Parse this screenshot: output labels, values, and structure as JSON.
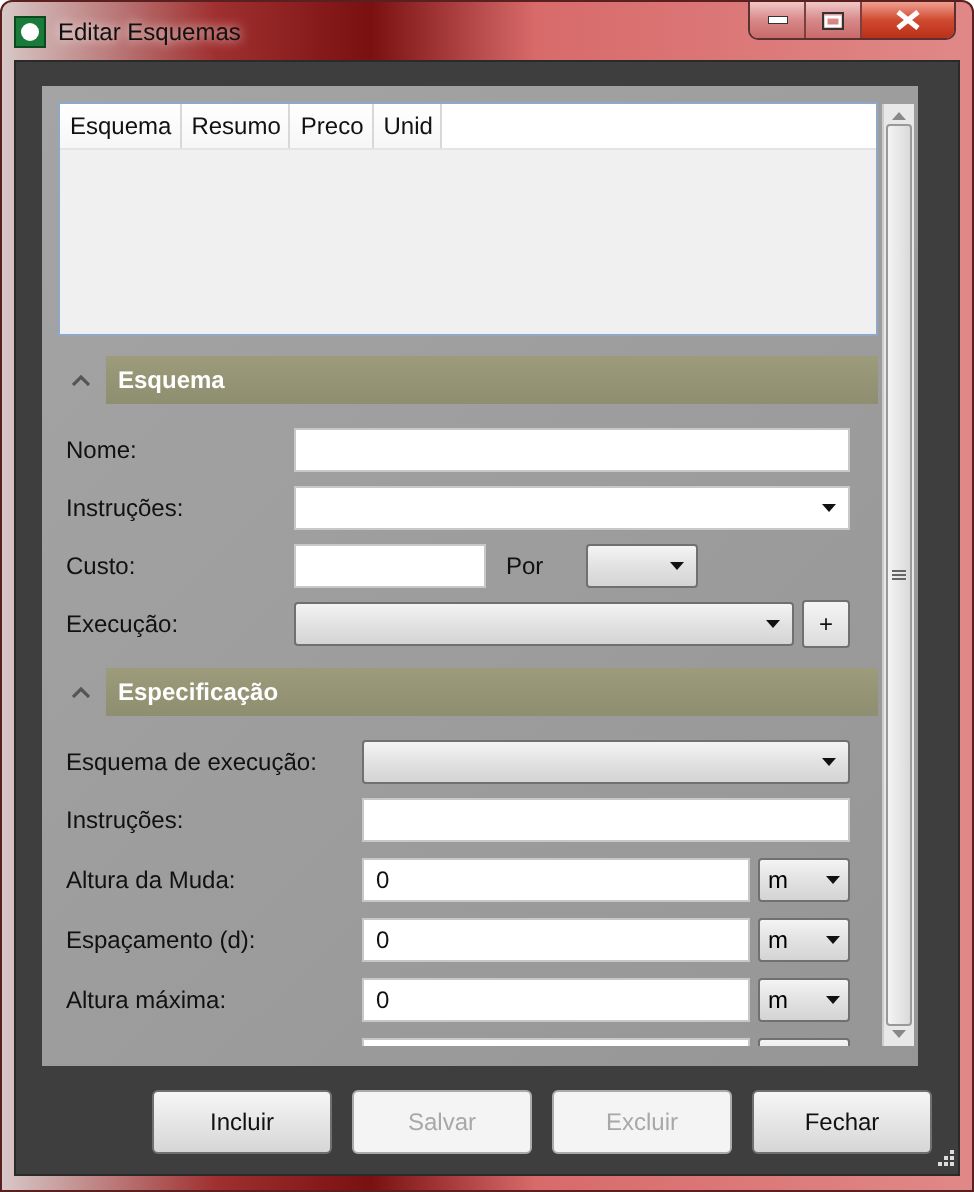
{
  "window": {
    "title": "Editar Esquemas"
  },
  "grid": {
    "columns": [
      "Esquema",
      "Resumo",
      "Preco",
      "Unid"
    ]
  },
  "sections": [
    {
      "title": "Esquema",
      "expanded": true,
      "fields": [
        {
          "kind": "text",
          "label": "Nome:"
        },
        {
          "kind": "editable_combo",
          "label": "Instruções:"
        },
        {
          "kind": "cost",
          "label": "Custo:",
          "per_label": "Por"
        },
        {
          "kind": "combo_add",
          "label": "Execução:",
          "button": "+"
        }
      ]
    },
    {
      "title": "Especificação",
      "expanded": true,
      "fields": [
        {
          "kind": "combo",
          "label": "Esquema de execução:"
        },
        {
          "kind": "text",
          "label": "Instruções:"
        },
        {
          "kind": "measure",
          "label": "Altura da Muda:",
          "value": "0",
          "unit": "m"
        },
        {
          "kind": "measure",
          "label": "Espaçamento (d):",
          "value": "0",
          "unit": "m"
        },
        {
          "kind": "measure",
          "label": "Altura máxima:",
          "value": "0",
          "unit": "m"
        },
        {
          "kind": "measure_cut"
        }
      ]
    }
  ],
  "buttons": [
    {
      "label": "Incluir",
      "disabled": false
    },
    {
      "label": "Salvar",
      "disabled": true
    },
    {
      "label": "Excluir",
      "disabled": true
    },
    {
      "label": "Fechar",
      "disabled": false
    }
  ]
}
